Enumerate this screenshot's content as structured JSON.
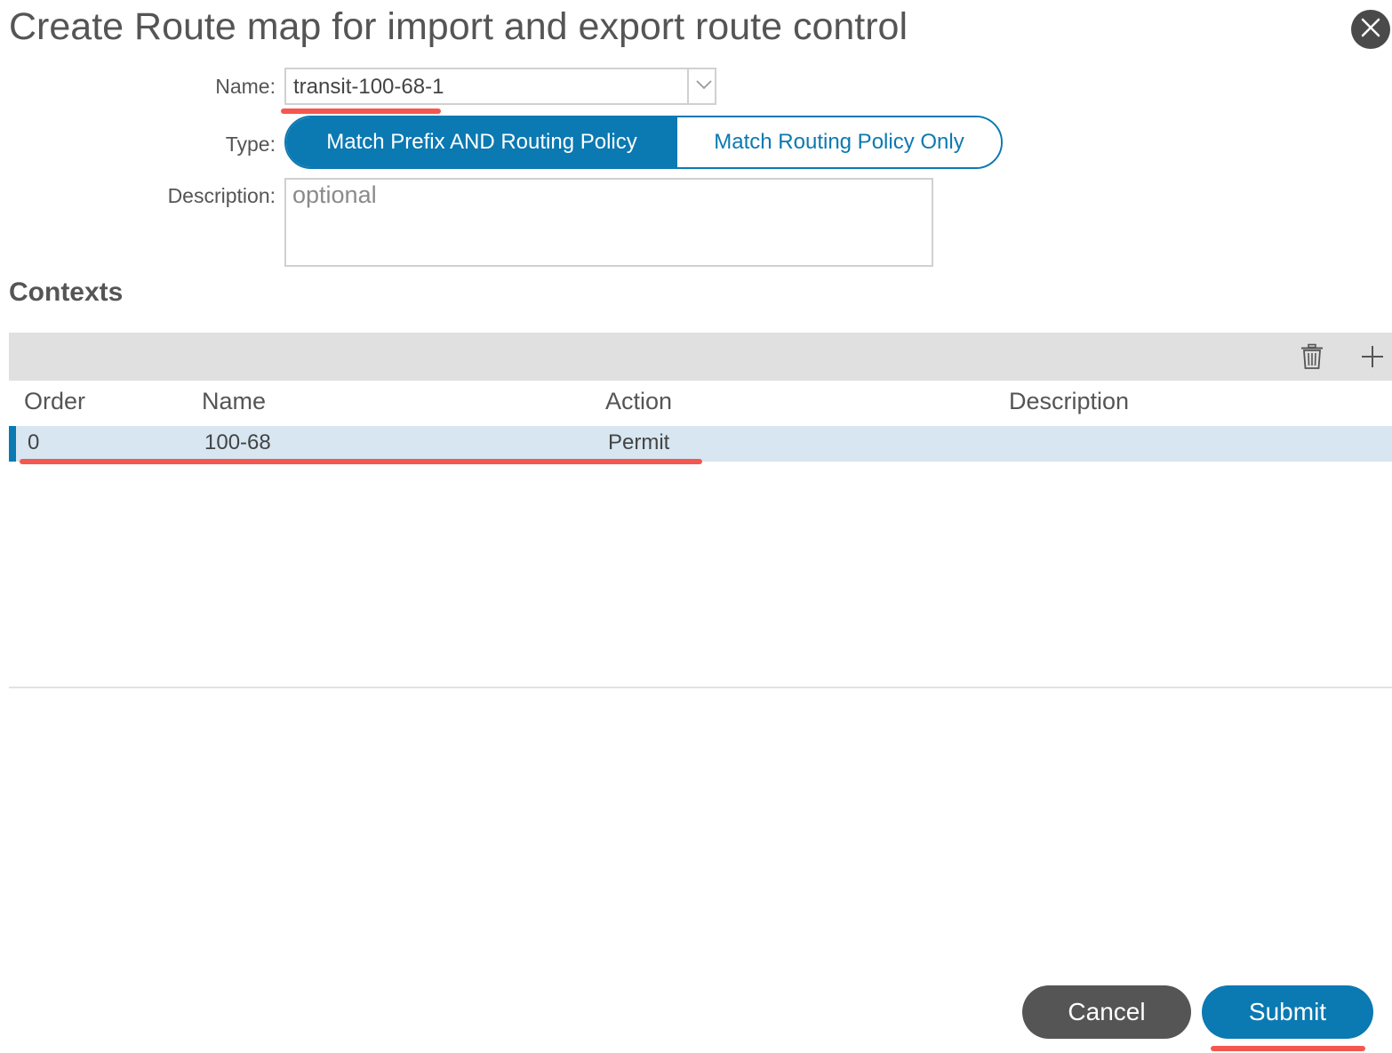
{
  "dialog": {
    "title": "Create Route map for import and export route control"
  },
  "form": {
    "name_label": "Name:",
    "name_value": "transit-100-68-1",
    "type_label": "Type:",
    "type_options": [
      {
        "label": "Match Prefix AND Routing Policy",
        "selected": true
      },
      {
        "label": "Match Routing Policy Only",
        "selected": false
      }
    ],
    "description_label": "Description:",
    "description_placeholder": "optional"
  },
  "contexts": {
    "heading": "Contexts",
    "columns": [
      "Order",
      "Name",
      "Action",
      "Description"
    ],
    "rows": [
      {
        "order": "0",
        "name": "100-68",
        "action": "Permit",
        "description": ""
      }
    ],
    "toolbar_icons": [
      "trash-icon",
      "plus-icon"
    ]
  },
  "footer": {
    "cancel_label": "Cancel",
    "submit_label": "Submit"
  },
  "colors": {
    "accent": "#0b79b2",
    "annotation": "#f4574f",
    "row_selected": "#d7e6f0",
    "toolbar": "#e0e0e0",
    "cancel": "#555555"
  }
}
